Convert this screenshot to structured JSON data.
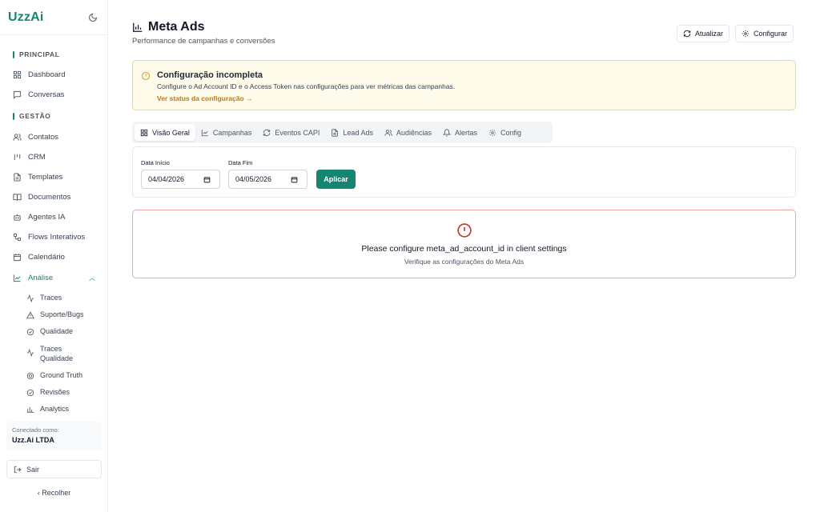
{
  "sidebar": {
    "brand": "UzzAi",
    "sections": {
      "principal": "PRINCIPAL",
      "gestao": "GESTÃO"
    },
    "items": {
      "dashboard": "Dashboard",
      "conversas": "Conversas",
      "contatos": "Contatos",
      "crm": "CRM",
      "templates": "Templates",
      "documentos": "Documentos",
      "agentes": "Agentes IA",
      "flows": "Flows Interativos",
      "calendario": "Calendário",
      "analise": "Análise"
    },
    "subitems": {
      "traces": "Traces",
      "suporte": "Suporte/Bugs",
      "qualidade": "Qualidade",
      "traces_qualidade_1": "Traces",
      "traces_qualidade_2": "Qualidade",
      "ground_truth": "Ground Truth",
      "revisoes": "Revisões",
      "analytics": "Analytics"
    },
    "connected_label": "Conectado como:",
    "connected_value": "Uzz.Ai LTDA",
    "logout": "Sair",
    "collapse": "‹   Recolher"
  },
  "header": {
    "title": "Meta Ads",
    "subtitle": "Performance de campanhas e conversões",
    "refresh_label": "Atualizar",
    "configure_label": "Configurar"
  },
  "alert": {
    "title": "Configuração incompleta",
    "text": "Configure o Ad Account ID e o Access Token nas configurações para ver métricas das campanhas.",
    "link": "Ver status da configuração →"
  },
  "tabs": {
    "overview": "Visão Geral",
    "campaigns": "Campanhas",
    "capi": "Eventos CAPI",
    "leadads": "Lead Ads",
    "audiences": "Audiências",
    "alerts": "Alertas",
    "config": "Config"
  },
  "filters": {
    "start_label": "Data Início",
    "start_value": "04/04/2026",
    "end_label": "Data Fim",
    "end_value": "04/05/2026",
    "apply_label": "Aplicar"
  },
  "error": {
    "title": "Please configure meta_ad_account_id in client settings",
    "subtitle": "Verifique as configurações do Meta Ads"
  },
  "colors": {
    "accent": "#16856f",
    "warning_bg": "#fffbeb",
    "warning_border": "#f5d67b",
    "error_border": "#f0a9a9",
    "error_icon": "#c0392b"
  }
}
